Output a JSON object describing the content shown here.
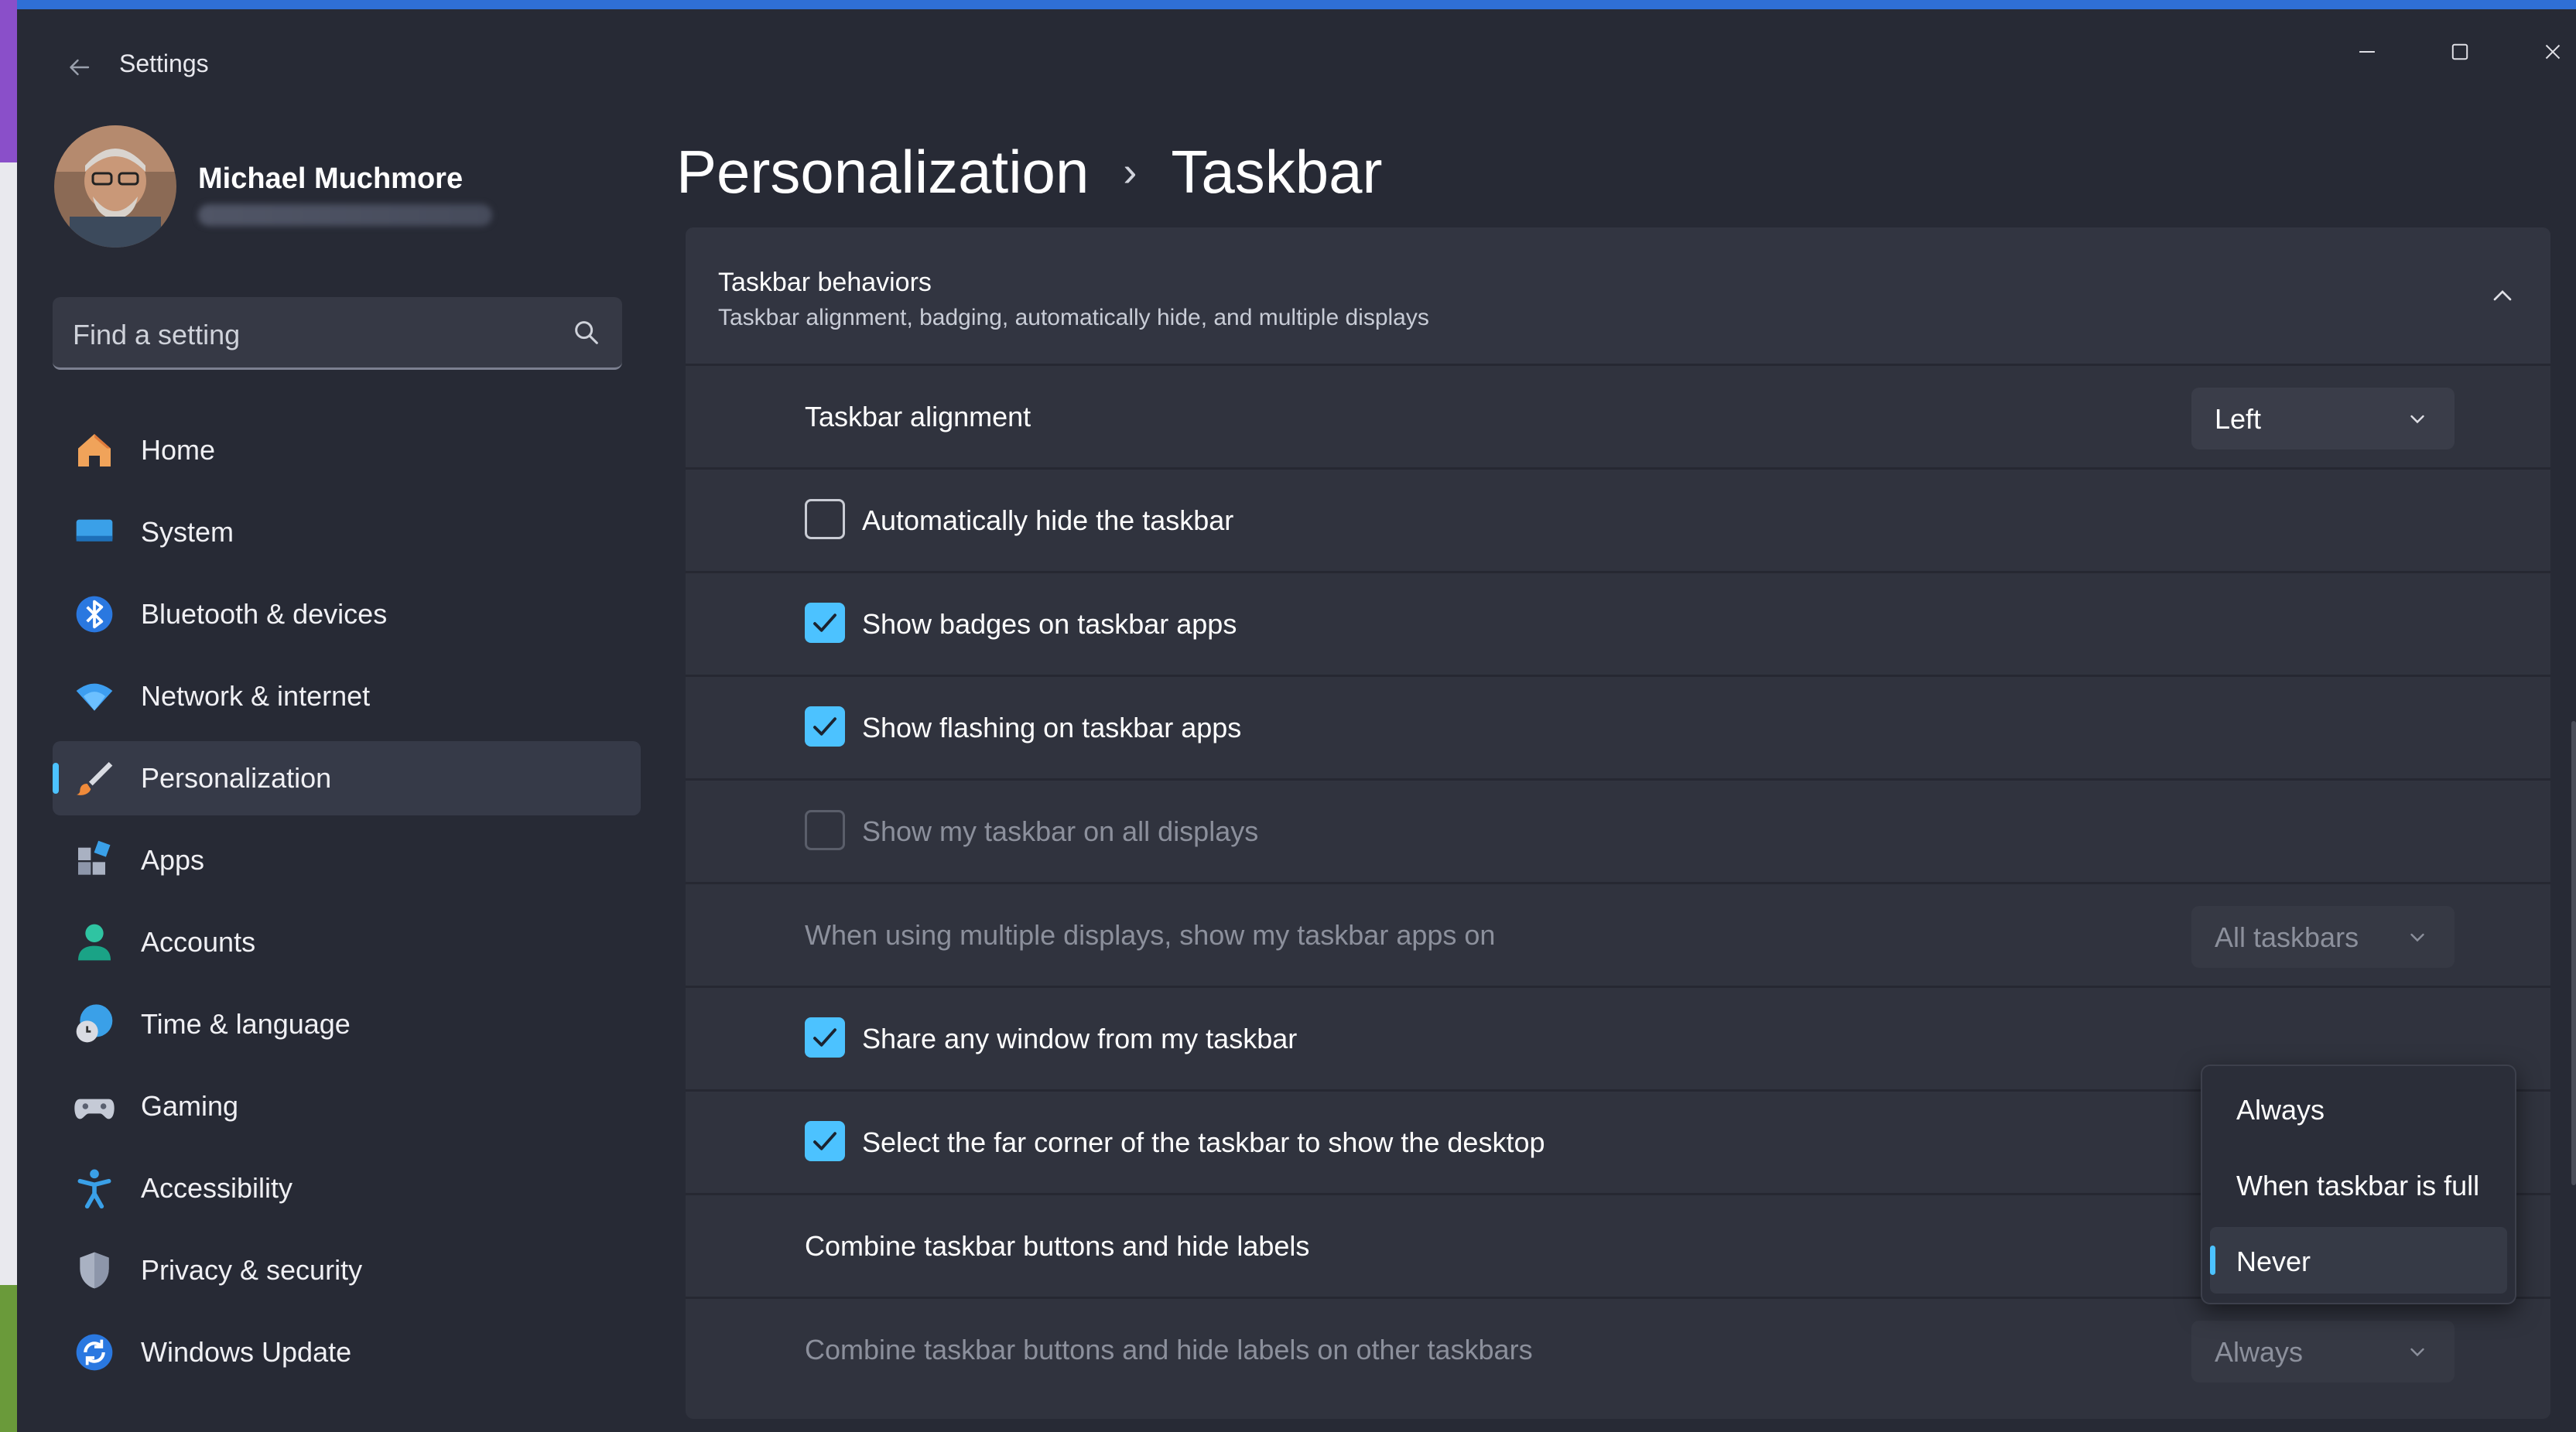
{
  "window": {
    "title": "Settings"
  },
  "user": {
    "name": "Michael Muchmore"
  },
  "search": {
    "placeholder": "Find a setting"
  },
  "sidebar": {
    "items": [
      {
        "label": "Home",
        "icon": "home-icon"
      },
      {
        "label": "System",
        "icon": "system-icon"
      },
      {
        "label": "Bluetooth & devices",
        "icon": "bluetooth-icon"
      },
      {
        "label": "Network & internet",
        "icon": "wifi-icon"
      },
      {
        "label": "Personalization",
        "icon": "paintbrush-icon",
        "active": true
      },
      {
        "label": "Apps",
        "icon": "apps-icon"
      },
      {
        "label": "Accounts",
        "icon": "accounts-icon"
      },
      {
        "label": "Time & language",
        "icon": "globe-clock-icon"
      },
      {
        "label": "Gaming",
        "icon": "gamepad-icon"
      },
      {
        "label": "Accessibility",
        "icon": "accessibility-icon"
      },
      {
        "label": "Privacy & security",
        "icon": "shield-icon"
      },
      {
        "label": "Windows Update",
        "icon": "update-icon"
      }
    ]
  },
  "breadcrumb": {
    "parent": "Personalization",
    "separator": "›",
    "current": "Taskbar"
  },
  "section": {
    "title": "Taskbar behaviors",
    "subtitle": "Taskbar alignment, badging, automatically hide, and multiple displays",
    "rows": [
      {
        "type": "dropdown",
        "label": "Taskbar alignment",
        "value": "Left",
        "enabled": true
      },
      {
        "type": "checkbox",
        "label": "Automatically hide the taskbar",
        "checked": false,
        "enabled": true
      },
      {
        "type": "checkbox",
        "label": "Show badges on taskbar apps",
        "checked": true,
        "enabled": true
      },
      {
        "type": "checkbox",
        "label": "Show flashing on taskbar apps",
        "checked": true,
        "enabled": true
      },
      {
        "type": "checkbox",
        "label": "Show my taskbar on all displays",
        "checked": false,
        "enabled": false
      },
      {
        "type": "dropdown",
        "label": "When using multiple displays, show my taskbar apps on",
        "value": "All taskbars",
        "enabled": false
      },
      {
        "type": "checkbox",
        "label": "Share any window from my taskbar",
        "checked": true,
        "enabled": true
      },
      {
        "type": "checkbox",
        "label": "Select the far corner of the taskbar to show the desktop",
        "checked": true,
        "enabled": true
      },
      {
        "type": "menu-open",
        "label": "Combine taskbar buttons and hide labels",
        "enabled": true
      },
      {
        "type": "dropdown",
        "label": "Combine taskbar buttons and hide labels on other taskbars",
        "value": "Always",
        "enabled": false
      }
    ]
  },
  "combine_menu": {
    "options": [
      "Always",
      "When taskbar is full",
      "Never"
    ],
    "selected": "Never"
  },
  "colors": {
    "accent": "#4cc2ff",
    "background": "#272a35",
    "card": "#30333e"
  }
}
